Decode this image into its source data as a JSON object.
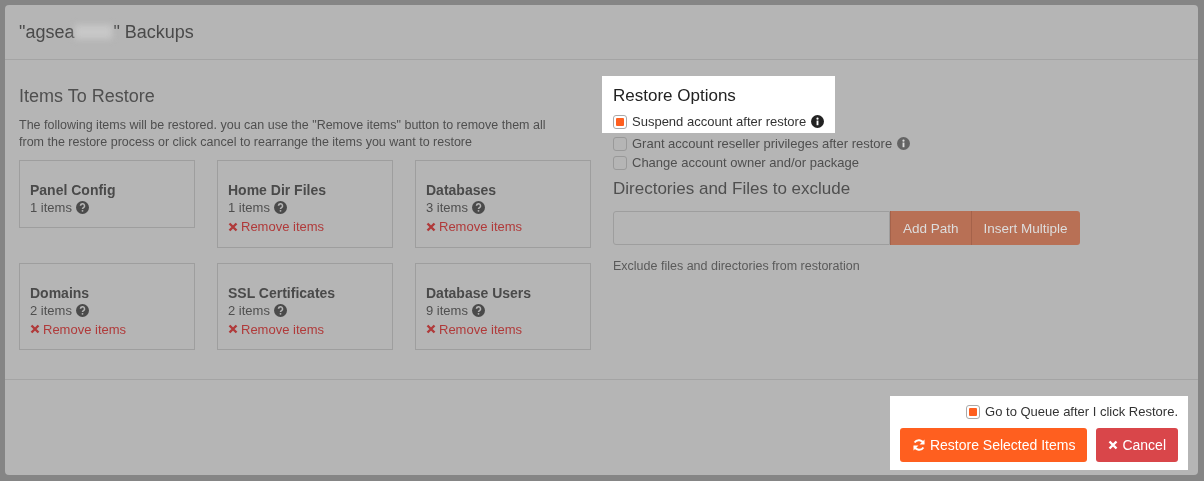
{
  "modal": {
    "title_start": "\"agsea",
    "title_end": "\" Backups"
  },
  "items_section": {
    "heading": "Items To Restore",
    "description": "The following items will be restored. you can use the \"Remove items\" button to remove them all from the restore process or click cancel to rearrange the items you want to restore"
  },
  "items": [
    {
      "name": "Panel Config",
      "count": "1 items"
    },
    {
      "name": "Home Dir Files",
      "count": "1 items",
      "remove_label": "Remove items"
    },
    {
      "name": "Databases",
      "count": "3 items",
      "remove_label": "Remove items"
    },
    {
      "name": "Domains",
      "count": "2 items",
      "remove_label": "Remove items"
    },
    {
      "name": "SSL Certificates",
      "count": "2 items",
      "remove_label": "Remove items"
    },
    {
      "name": "Database Users",
      "count": "9 items",
      "remove_label": "Remove items"
    }
  ],
  "restore_options": {
    "heading": "Restore Options",
    "options": [
      {
        "label": "Suspend account after restore",
        "checked": true,
        "info": true,
        "highlighted": true
      },
      {
        "label": "Grant account reseller privileges after restore",
        "checked": false,
        "info": true,
        "highlighted": false
      },
      {
        "label": "Change account owner and/or package",
        "checked": false,
        "info": false,
        "highlighted": false
      }
    ]
  },
  "exclude": {
    "heading": "Directories and Files to exclude",
    "add_button": "Add Path",
    "insert_button": "Insert Multiple",
    "help": "Exclude files and directories from restoration"
  },
  "footer": {
    "highlighted": true,
    "queue_label": "Go to Queue after I click Restore.",
    "queue_checked": true,
    "restore_button": "Restore Selected Items",
    "cancel_button": "Cancel"
  }
}
